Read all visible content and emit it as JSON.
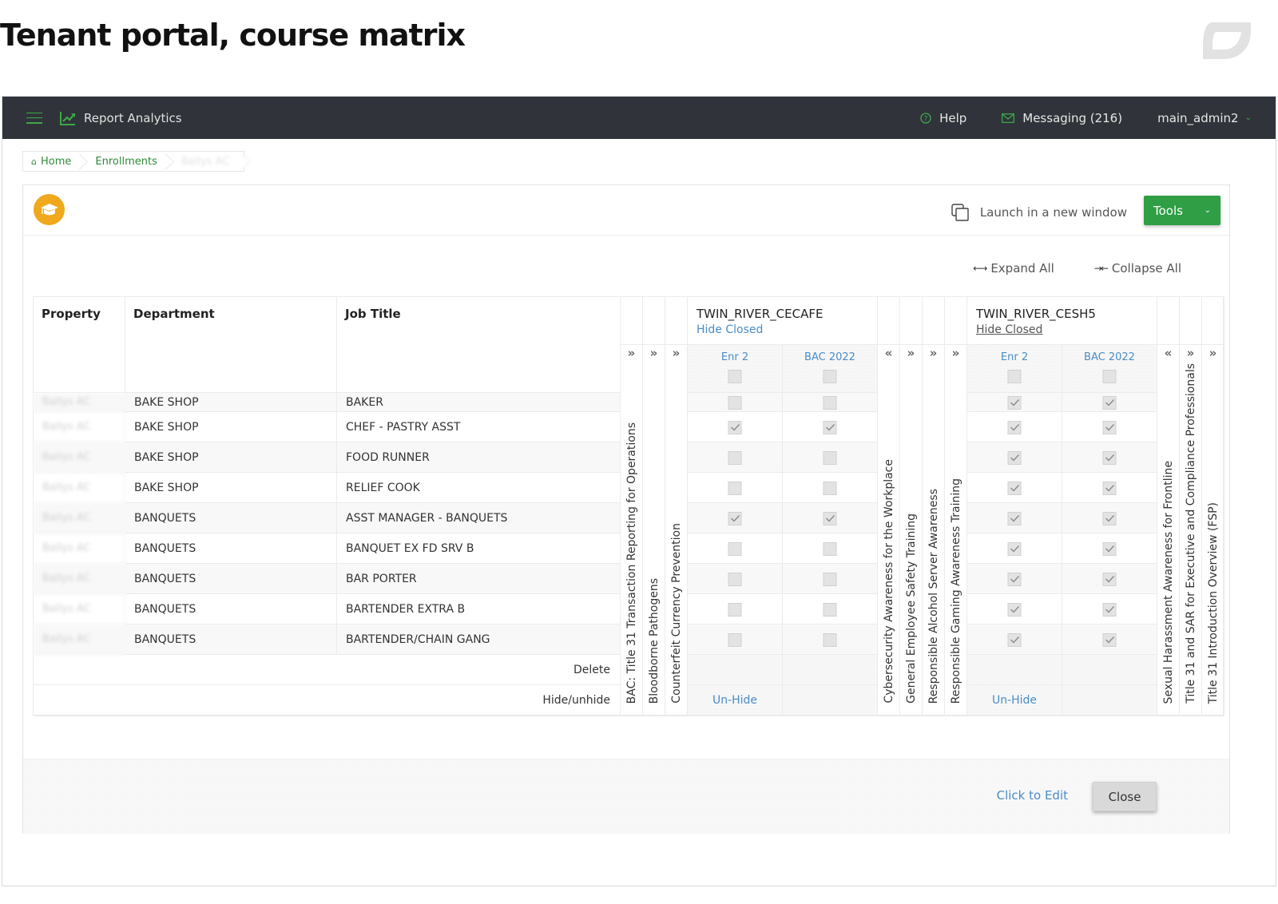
{
  "page": {
    "title": "Tenant portal, course matrix",
    "logo_icon": "leaf-outline-logo"
  },
  "topbar": {
    "app_name": "Report Analytics",
    "menu_icon": "hamburger-icon",
    "app_icon": "line-chart-icon",
    "help_label": "Help",
    "messaging_label": "Messaging (216)",
    "user_label": "main_admin2",
    "accent_color": "#3ca84a",
    "bg_color": "#30343a"
  },
  "breadcrumb": {
    "items": [
      {
        "label": "Home",
        "icon": "home-icon"
      },
      {
        "label": "Enrollments"
      },
      {
        "label": "Ballys AC",
        "redacted": true
      }
    ]
  },
  "panel": {
    "course_icon": "graduation-cap-icon",
    "launch_label": "Launch in a new window",
    "tools_label": "Tools",
    "expand_all_label": "Expand All",
    "collapse_all_label": "Collapse All",
    "tools_color": "#2f9e44"
  },
  "matrix": {
    "columns": {
      "property": "Property",
      "department": "Department",
      "job_title": "Job Title"
    },
    "course_columns": [
      {
        "type": "course",
        "label": "BAC: Title 31 Transaction Reporting for Operations",
        "toggle": "»"
      },
      {
        "type": "course",
        "label": "Bloodborne Pathogens",
        "toggle": "»"
      },
      {
        "type": "course",
        "label": "Counterfeit Currency Prevention",
        "toggle": "»"
      },
      {
        "type": "group",
        "name": "TWIN_RIVER_CECAFE",
        "hide_closed": "Hide Closed",
        "sub": [
          "Enr 2",
          "BAC 2022"
        ],
        "unhide": "Un-Hide"
      },
      {
        "type": "course",
        "label": "Cybersecurity Awareness for the Workplace",
        "toggle": "«"
      },
      {
        "type": "course",
        "label": "General Employee Safety Training",
        "toggle": "»"
      },
      {
        "type": "course",
        "label": "Responsible Alcohol Server Awareness",
        "toggle": "»"
      },
      {
        "type": "course",
        "label": "Responsible Gaming Awareness Training",
        "toggle": "»"
      },
      {
        "type": "group",
        "name": "TWIN_RIVER_CESH5",
        "hide_closed": "Hide Closed",
        "sub": [
          "Enr 2",
          "BAC 2022"
        ],
        "unhide": "Un-Hide"
      },
      {
        "type": "course",
        "label": "Sexual Harassment Awareness for Frontline",
        "toggle": "«"
      },
      {
        "type": "course",
        "label": "Title 31 and SAR for Executive and Compliance Professionals",
        "toggle": "»"
      },
      {
        "type": "course",
        "label": "Title 31 Introduction Overview (FSP)",
        "toggle": "»"
      }
    ],
    "rows": [
      {
        "property": "Ballys AC",
        "department": "BAKE SHOP",
        "job_title": "BAKER",
        "cecafe": [
          false,
          false
        ],
        "cesh5": [
          true,
          true
        ]
      },
      {
        "property": "Ballys AC",
        "department": "BAKE SHOP",
        "job_title": "CHEF - PASTRY ASST",
        "cecafe": [
          true,
          true
        ],
        "cesh5": [
          true,
          true
        ]
      },
      {
        "property": "Ballys AC",
        "department": "BAKE SHOP",
        "job_title": "FOOD RUNNER",
        "cecafe": [
          false,
          false
        ],
        "cesh5": [
          true,
          true
        ]
      },
      {
        "property": "Ballys AC",
        "department": "BAKE SHOP",
        "job_title": "RELIEF COOK",
        "cecafe": [
          false,
          false
        ],
        "cesh5": [
          true,
          true
        ]
      },
      {
        "property": "Ballys AC",
        "department": "BANQUETS",
        "job_title": "ASST MANAGER - BANQUETS",
        "cecafe": [
          true,
          true
        ],
        "cesh5": [
          true,
          true
        ]
      },
      {
        "property": "Ballys AC",
        "department": "BANQUETS",
        "job_title": "BANQUET EX FD SRV B",
        "cecafe": [
          false,
          false
        ],
        "cesh5": [
          true,
          true
        ]
      },
      {
        "property": "Ballys AC",
        "department": "BANQUETS",
        "job_title": "BAR PORTER",
        "cecafe": [
          false,
          false
        ],
        "cesh5": [
          true,
          true
        ]
      },
      {
        "property": "Ballys AC",
        "department": "BANQUETS",
        "job_title": "BARTENDER EXTRA B",
        "cecafe": [
          false,
          false
        ],
        "cesh5": [
          true,
          true
        ]
      },
      {
        "property": "Ballys AC",
        "department": "BANQUETS",
        "job_title": "BARTENDER/CHAIN GANG",
        "cecafe": [
          false,
          false
        ],
        "cesh5": [
          true,
          true
        ]
      }
    ],
    "header_checks": {
      "cecafe": [
        false,
        false
      ],
      "cesh5": [
        false,
        false
      ]
    },
    "delete_label": "Delete",
    "hide_unhide_label": "Hide/unhide"
  },
  "footer": {
    "click_to_edit": "Click to Edit",
    "close_label": "Close",
    "link_color": "#4a8cc7"
  }
}
